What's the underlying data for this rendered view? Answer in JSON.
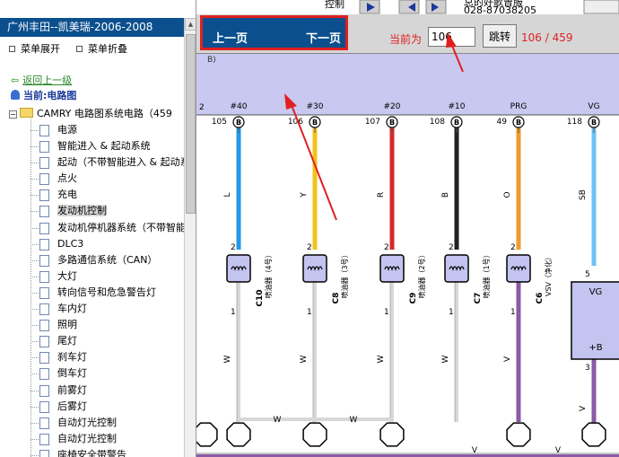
{
  "app": {
    "title": "广州丰田--凯美瑞-2006-2008",
    "top_right_label": "控制",
    "top_right_info": "总的好歌曾服 ",
    "top_right_phone": "028-87038205"
  },
  "left_menu": {
    "expand_label": "菜单展开",
    "collapse_label": "菜单折叠",
    "back_label": "返回上一级",
    "current_label": "当前:电路图",
    "root_label": "CAMRY 电路图系统电路（459"
  },
  "tree_items": [
    {
      "label": "电源"
    },
    {
      "label": "智能进入 & 起动系统"
    },
    {
      "label": "起动（不带智能进入 & 起动系"
    },
    {
      "label": "点火"
    },
    {
      "label": "充电"
    },
    {
      "label": "发动机控制",
      "selected": true
    },
    {
      "label": "发动机停机器系统（不带智能"
    },
    {
      "label": "DLC3"
    },
    {
      "label": "多路通信系统（CAN）"
    },
    {
      "label": "大灯"
    },
    {
      "label": "转向信号和危急警告灯"
    },
    {
      "label": "车内灯"
    },
    {
      "label": "照明"
    },
    {
      "label": "尾灯"
    },
    {
      "label": "刹车灯"
    },
    {
      "label": "倒车灯"
    },
    {
      "label": "前雾灯"
    },
    {
      "label": "后雾灯"
    },
    {
      "label": "自动灯光控制"
    },
    {
      "label": "自动灯光控制"
    },
    {
      "label": "座椅安全带警告"
    }
  ],
  "toolbar": {
    "prev_label": "上一页",
    "next_label": "下一页",
    "current_label": "当前为",
    "page_value": "106",
    "jump_label": "跳转",
    "page_count": "106 / 459"
  },
  "diagram": {
    "header_label": "B)",
    "colors": {
      "band": "#c8c8f0",
      "ecu_fill": "#c4c4f0",
      "wire_L": "#1f9ae8",
      "wire_Y": "#f2c21a",
      "wire_R": "#d42a2a",
      "wire_B": "#222222",
      "wire_O": "#f39a2a",
      "wire_SB": "#6cc2f4",
      "wire_V": "#8a5aa6",
      "wire_W": "#d8d8d8",
      "arrow_red": "#e02020"
    },
    "pins": [
      {
        "name": "#40",
        "num": "105",
        "code": "L",
        "color": "wire_L"
      },
      {
        "name": "#30",
        "num": "106",
        "code": "Y",
        "color": "wire_Y"
      },
      {
        "name": "#20",
        "num": "107",
        "code": "R",
        "color": "wire_R"
      },
      {
        "name": "#10",
        "num": "108",
        "code": "B",
        "color": "wire_B"
      },
      {
        "name": "PRG",
        "num": "49",
        "code": "O",
        "color": "wire_O"
      },
      {
        "name": "VG",
        "num": "118",
        "code": "SB",
        "color": "wire_SB"
      }
    ],
    "left_edge_num": "2",
    "injectors": [
      {
        "id": "C10",
        "name": "喷油器（4号）"
      },
      {
        "id": "C8",
        "name": "喷油器（3号）"
      },
      {
        "id": "C9",
        "name": "喷油器（2号）"
      },
      {
        "id": "C7",
        "name": "喷油器（1号）"
      },
      {
        "id": "C6",
        "name": "VSV（净化）"
      }
    ],
    "pin_top": "2",
    "pin_bottom": "1",
    "wire_W": "W",
    "wire_V": "V",
    "maf": {
      "vg": "VG",
      "b": "+B",
      "pin_top": "5",
      "pin_bottom": "3"
    }
  }
}
